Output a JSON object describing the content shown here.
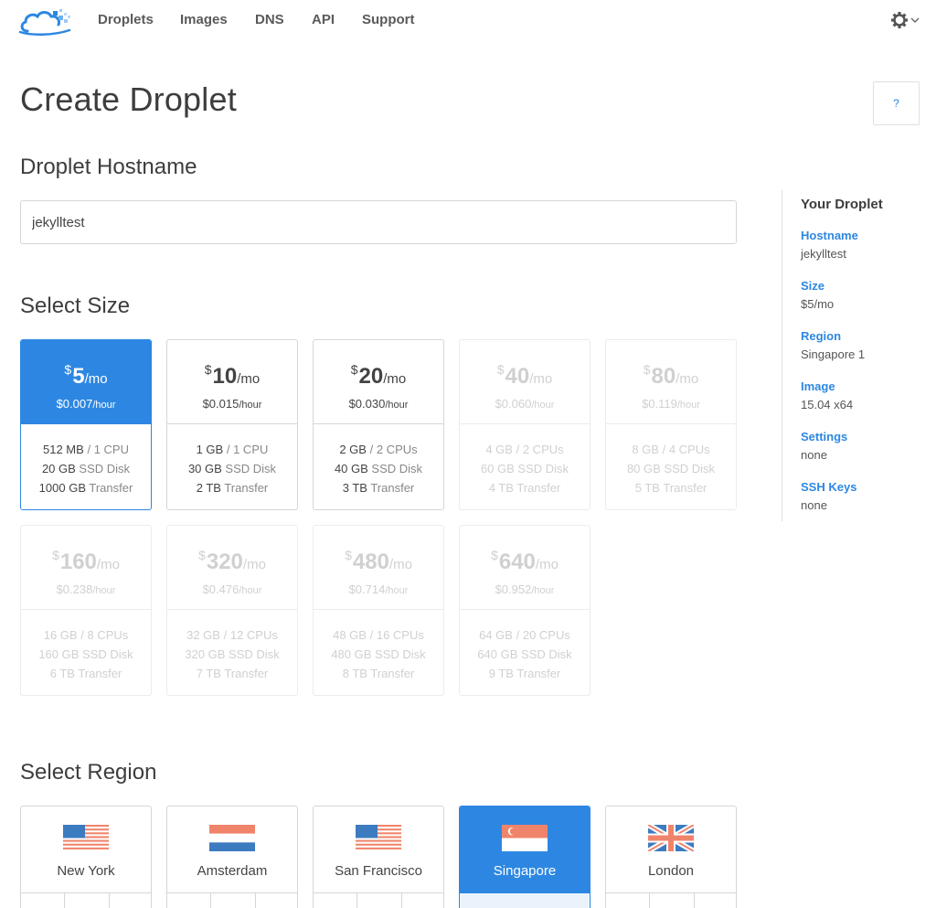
{
  "nav": {
    "items": [
      "Droplets",
      "Images",
      "DNS",
      "API",
      "Support"
    ]
  },
  "page": {
    "title": "Create Droplet",
    "help_label": "?"
  },
  "hostname": {
    "heading": "Droplet Hostname",
    "value": "jekylltest"
  },
  "size": {
    "heading": "Select Size",
    "currency": "$",
    "per_month": "/mo",
    "per_hour": "/hour",
    "plans": [
      {
        "price": "5",
        "hourly": "$0.007",
        "ram": "512 MB",
        "cpu": "1 CPU",
        "disk": "20 GB",
        "transfer": "1000 GB",
        "state": "selected"
      },
      {
        "price": "10",
        "hourly": "$0.015",
        "ram": "1 GB",
        "cpu": "1 CPU",
        "disk": "30 GB",
        "transfer": "2 TB",
        "state": "normal"
      },
      {
        "price": "20",
        "hourly": "$0.030",
        "ram": "2 GB",
        "cpu": "2 CPUs",
        "disk": "40 GB",
        "transfer": "3 TB",
        "state": "normal"
      },
      {
        "price": "40",
        "hourly": "$0.060",
        "ram": "4 GB",
        "cpu": "2 CPUs",
        "disk": "60 GB",
        "transfer": "4 TB",
        "state": "disabled"
      },
      {
        "price": "80",
        "hourly": "$0.119",
        "ram": "8 GB",
        "cpu": "4 CPUs",
        "disk": "80 GB",
        "transfer": "5 TB",
        "state": "disabled"
      },
      {
        "price": "160",
        "hourly": "$0.238",
        "ram": "16 GB",
        "cpu": "8 CPUs",
        "disk": "160 GB",
        "transfer": "6 TB",
        "state": "disabled"
      },
      {
        "price": "320",
        "hourly": "$0.476",
        "ram": "32 GB",
        "cpu": "12 CPUs",
        "disk": "320 GB",
        "transfer": "7 TB",
        "state": "disabled"
      },
      {
        "price": "480",
        "hourly": "$0.714",
        "ram": "48 GB",
        "cpu": "16 CPUs",
        "disk": "480 GB",
        "transfer": "8 TB",
        "state": "disabled"
      },
      {
        "price": "640",
        "hourly": "$0.952",
        "ram": "64 GB",
        "cpu": "20 CPUs",
        "disk": "640 GB",
        "transfer": "9 TB",
        "state": "disabled"
      }
    ],
    "sep": "/",
    "disk_label": "SSD Disk",
    "transfer_label": "Transfer"
  },
  "region": {
    "heading": "Select Region",
    "items": [
      {
        "name": "New York",
        "flag": "us-flag-icon",
        "state": "normal"
      },
      {
        "name": "Amsterdam",
        "flag": "nl-flag-icon",
        "state": "normal"
      },
      {
        "name": "San Francisco",
        "flag": "us-flag-icon",
        "state": "normal"
      },
      {
        "name": "Singapore",
        "flag": "sg-flag-icon",
        "state": "selected"
      },
      {
        "name": "London",
        "flag": "uk-flag-icon",
        "state": "normal"
      }
    ]
  },
  "sidebar": {
    "title": "Your Droplet",
    "fields": [
      {
        "key": "Hostname",
        "value": "jekylltest"
      },
      {
        "key": "Size",
        "value": "$5/mo"
      },
      {
        "key": "Region",
        "value": "Singapore 1"
      },
      {
        "key": "Image",
        "value": "15.04 x64"
      },
      {
        "key": "Settings",
        "value": "none"
      },
      {
        "key": "SSH Keys",
        "value": "none"
      }
    ]
  },
  "colors": {
    "accent": "#2d87e2",
    "text": "#444444",
    "disabled": "#d0d0d0",
    "border": "#d6d6d6"
  }
}
